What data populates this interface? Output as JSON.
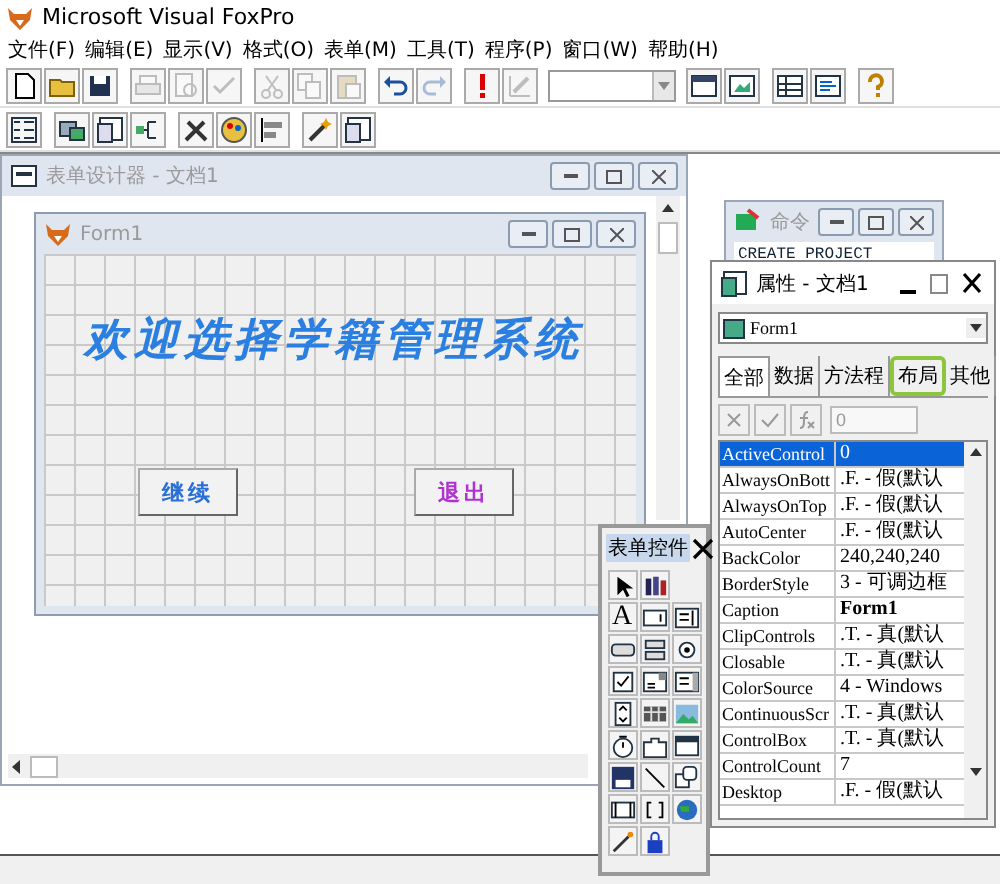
{
  "app": {
    "title": "Microsoft Visual FoxPro"
  },
  "menu": [
    "文件(F)",
    "编辑(E)",
    "显示(V)",
    "格式(O)",
    "表单(M)",
    "工具(T)",
    "程序(P)",
    "窗口(W)",
    "帮助(H)"
  ],
  "toolbar": [
    {
      "disabled": false
    },
    {
      "disabled": false
    },
    {
      "disabled": false
    },
    {
      "disabled": true
    },
    {
      "disabled": true
    },
    {
      "disabled": true
    },
    {
      "disabled": true
    },
    {
      "disabled": true
    },
    {
      "disabled": true
    },
    {
      "disabled": false
    },
    {
      "disabled": true
    },
    {
      "disabled": false
    },
    {
      "disabled": true
    }
  ],
  "form_designer": {
    "title": "表单设计器 - 文档1",
    "active": false,
    "form": {
      "title": "Form1",
      "active": false,
      "heading": "欢迎选择学籍管理系统",
      "buttons": [
        {
          "caption": "继续",
          "color": "#2a6fd6"
        },
        {
          "caption": "退出",
          "color": "#b030d0"
        }
      ]
    }
  },
  "command_window": {
    "title": "命令",
    "active": false,
    "lines": [
      "CREATE PROJECT"
    ]
  },
  "properties": {
    "title": "属性 - 文档1",
    "active": true,
    "object": "Form1",
    "tabs": [
      {
        "label": "全部",
        "selected": true,
        "highlighted": false
      },
      {
        "label": "数据",
        "selected": false,
        "highlighted": false
      },
      {
        "label": "方法程",
        "selected": false,
        "highlighted": false
      },
      {
        "label": "布局",
        "selected": false,
        "highlighted": true
      },
      {
        "label": "其他",
        "selected": false,
        "highlighted": false
      }
    ],
    "edit_value": "0",
    "rows": [
      {
        "name": "ActiveControl",
        "value": "0",
        "selected": true,
        "bold": false
      },
      {
        "name": "AlwaysOnBott",
        "value": ".F. - 假(默认",
        "selected": false,
        "bold": false
      },
      {
        "name": "AlwaysOnTop",
        "value": ".F. - 假(默认",
        "selected": false,
        "bold": false
      },
      {
        "name": "AutoCenter",
        "value": ".F. - 假(默认",
        "selected": false,
        "bold": false
      },
      {
        "name": "BackColor",
        "value": "240,240,240",
        "selected": false,
        "bold": false
      },
      {
        "name": "BorderStyle",
        "value": "3 - 可调边框",
        "selected": false,
        "bold": false
      },
      {
        "name": "Caption",
        "value": "Form1",
        "selected": false,
        "bold": true
      },
      {
        "name": "ClipControls",
        "value": ".T. - 真(默认",
        "selected": false,
        "bold": false
      },
      {
        "name": "Closable",
        "value": ".T. - 真(默认",
        "selected": false,
        "bold": false
      },
      {
        "name": "ColorSource",
        "value": "4 - Windows",
        "selected": false,
        "bold": false
      },
      {
        "name": "ContinuousScr",
        "value": ".T. - 真(默认",
        "selected": false,
        "bold": false
      },
      {
        "name": "ControlBox",
        "value": ".T. - 真(默认",
        "selected": false,
        "bold": false
      },
      {
        "name": "ControlCount",
        "value": "7",
        "selected": false,
        "bold": false
      },
      {
        "name": "Desktop",
        "value": ".F. - 假(默认",
        "selected": false,
        "bold": false
      }
    ]
  },
  "form_controls": {
    "title": "表单控件",
    "label_tool": "A"
  }
}
